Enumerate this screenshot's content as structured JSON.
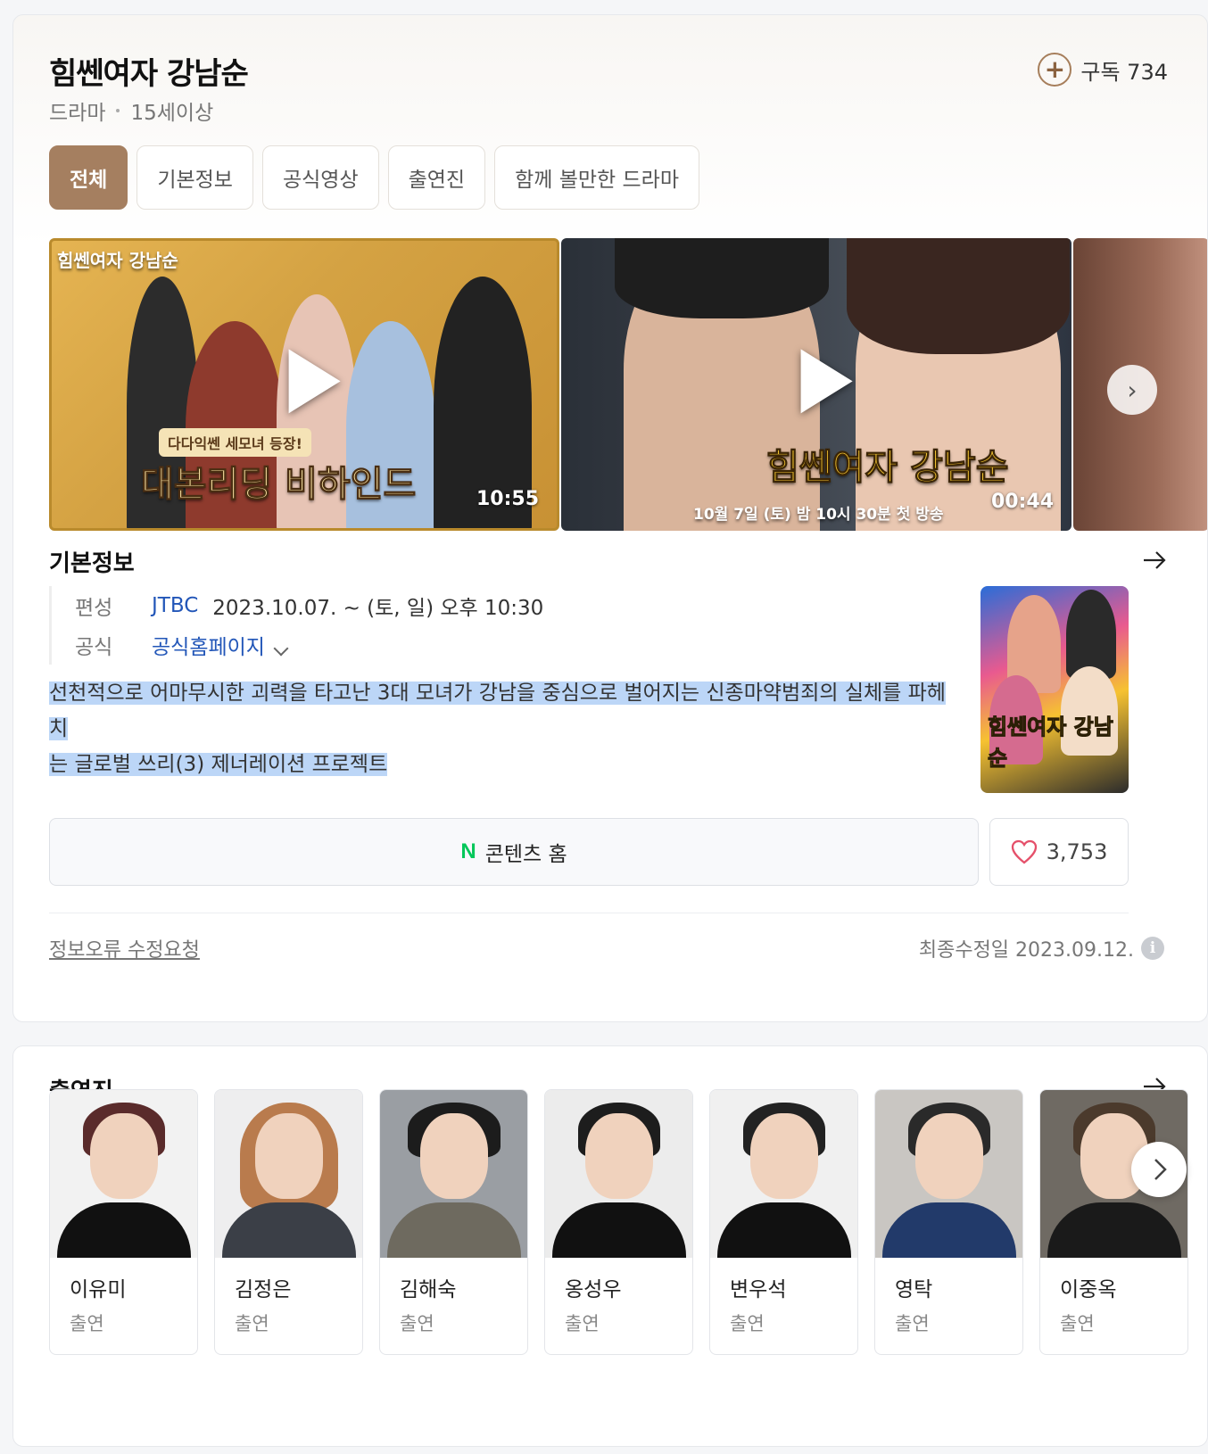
{
  "header": {
    "title": "힘쎈여자 강남순",
    "genre": "드라마",
    "rating": "15세이상",
    "subscribe_label": "구독 734"
  },
  "tabs": [
    {
      "label": "전체",
      "active": true
    },
    {
      "label": "기본정보",
      "active": false
    },
    {
      "label": "공식영상",
      "active": false
    },
    {
      "label": "출연진",
      "active": false
    },
    {
      "label": "함께 볼만한 드라마",
      "active": false
    }
  ],
  "videos": [
    {
      "duration": "10:55",
      "logo": "힘쎈여자 강남순",
      "caption_small": "다다익쎈 세모녀 등장!",
      "caption_big": "대본리딩 비하인드"
    },
    {
      "duration": "00:44",
      "caption_big": "힘쎈여자 강남순",
      "caption_small": "10월 7일 (토) 밤 10시 30분 첫 방송"
    }
  ],
  "basic_info": {
    "section_title": "기본정보",
    "broadcast_label": "편성",
    "broadcaster": "JTBC",
    "schedule": "2023.10.07. ~  (토, 일) 오후 10:30",
    "official_label": "공식",
    "homepage_link": "공식홈페이지",
    "description_line1": "선천적으로 어마무시한 괴력을 타고난 3대 모녀가 강남을 중심으로 벌어지는 신종마약범죄의 실체를 파헤치",
    "description_line2": "는 글로벌 쓰리(3) 제너레이션 프로젝트",
    "poster_title": "힘쎈여자 강남순"
  },
  "actions": {
    "content_home_logo": "N",
    "content_home_label": "콘텐츠 홈",
    "like_count": "3,753"
  },
  "footer": {
    "report_label": "정보오류 수정요청",
    "updated_label": "최종수정일 2023.09.12."
  },
  "cast": {
    "section_title": "출연진",
    "members": [
      {
        "name": "이유미",
        "role": "출연"
      },
      {
        "name": "김정은",
        "role": "출연"
      },
      {
        "name": "김해숙",
        "role": "출연"
      },
      {
        "name": "옹성우",
        "role": "출연"
      },
      {
        "name": "변우석",
        "role": "출연"
      },
      {
        "name": "영탁",
        "role": "출연"
      },
      {
        "name": "이중옥",
        "role": "출연"
      }
    ]
  },
  "colors": {
    "accent": "#a57f60",
    "link": "#2256b8",
    "naver_green": "#03c75a",
    "heart": "#e5506a",
    "highlight": "#bcd6f7"
  }
}
